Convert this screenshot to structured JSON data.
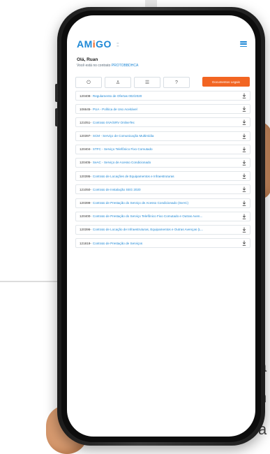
{
  "background": {
    "right_letters": [
      "l",
      "a",
      "n",
      "a"
    ]
  },
  "app": {
    "logo": {
      "main": "AM",
      "accent": "i",
      "rest": "GO",
      "sub": ""
    },
    "greeting": "Olá, Ruan",
    "contract_prefix": "Você está no contrato ",
    "contract_id": "PROTOBBDHCA",
    "tabs": [
      {
        "icon": "power-icon",
        "glyph": "⏻"
      },
      {
        "icon": "user-icon",
        "glyph": "♙"
      },
      {
        "icon": "list-icon",
        "glyph": "☰"
      },
      {
        "icon": "help-icon",
        "glyph": "?"
      }
    ],
    "documents_button": "Documentos Legais",
    "documents": [
      {
        "code": "120408",
        "title": "Regulamento de Ofertas 002/2020"
      },
      {
        "code": "106645",
        "title": "PUA - Política de Uso Aceitável"
      },
      {
        "code": "121051",
        "title": "Contrato SVA/SRV OnlineTec"
      },
      {
        "code": "120397",
        "title": "SCM - Serviço de Comunicação Multimídia"
      },
      {
        "code": "120404",
        "title": "STFC - Serviço Telefônico Fixo Comutado"
      },
      {
        "code": "120405",
        "title": "SeAC - Serviço de Acesso Condicionado"
      },
      {
        "code": "120395",
        "title": "Contrato de Locações de Equipamentos e Infraestruturas"
      },
      {
        "code": "121050",
        "title": "Contrato de Instalação SEG 2020"
      },
      {
        "code": "120399",
        "title": "Contrato de Prestação do Serviço de Acesso Condicionado (SeAC)"
      },
      {
        "code": "120400",
        "title": "Contrato de Prestação do Serviço Telefônico Fixo Comutado e Outras Aven..."
      },
      {
        "code": "120396",
        "title": "Contrato de Locação de Infraestruturas, Equipamentos e Outras Avenças (L..."
      },
      {
        "code": "121819",
        "title": "Contrato de Prestação de Serviços"
      }
    ]
  },
  "colors": {
    "primary": "#1e88d6",
    "accent": "#f26522"
  }
}
